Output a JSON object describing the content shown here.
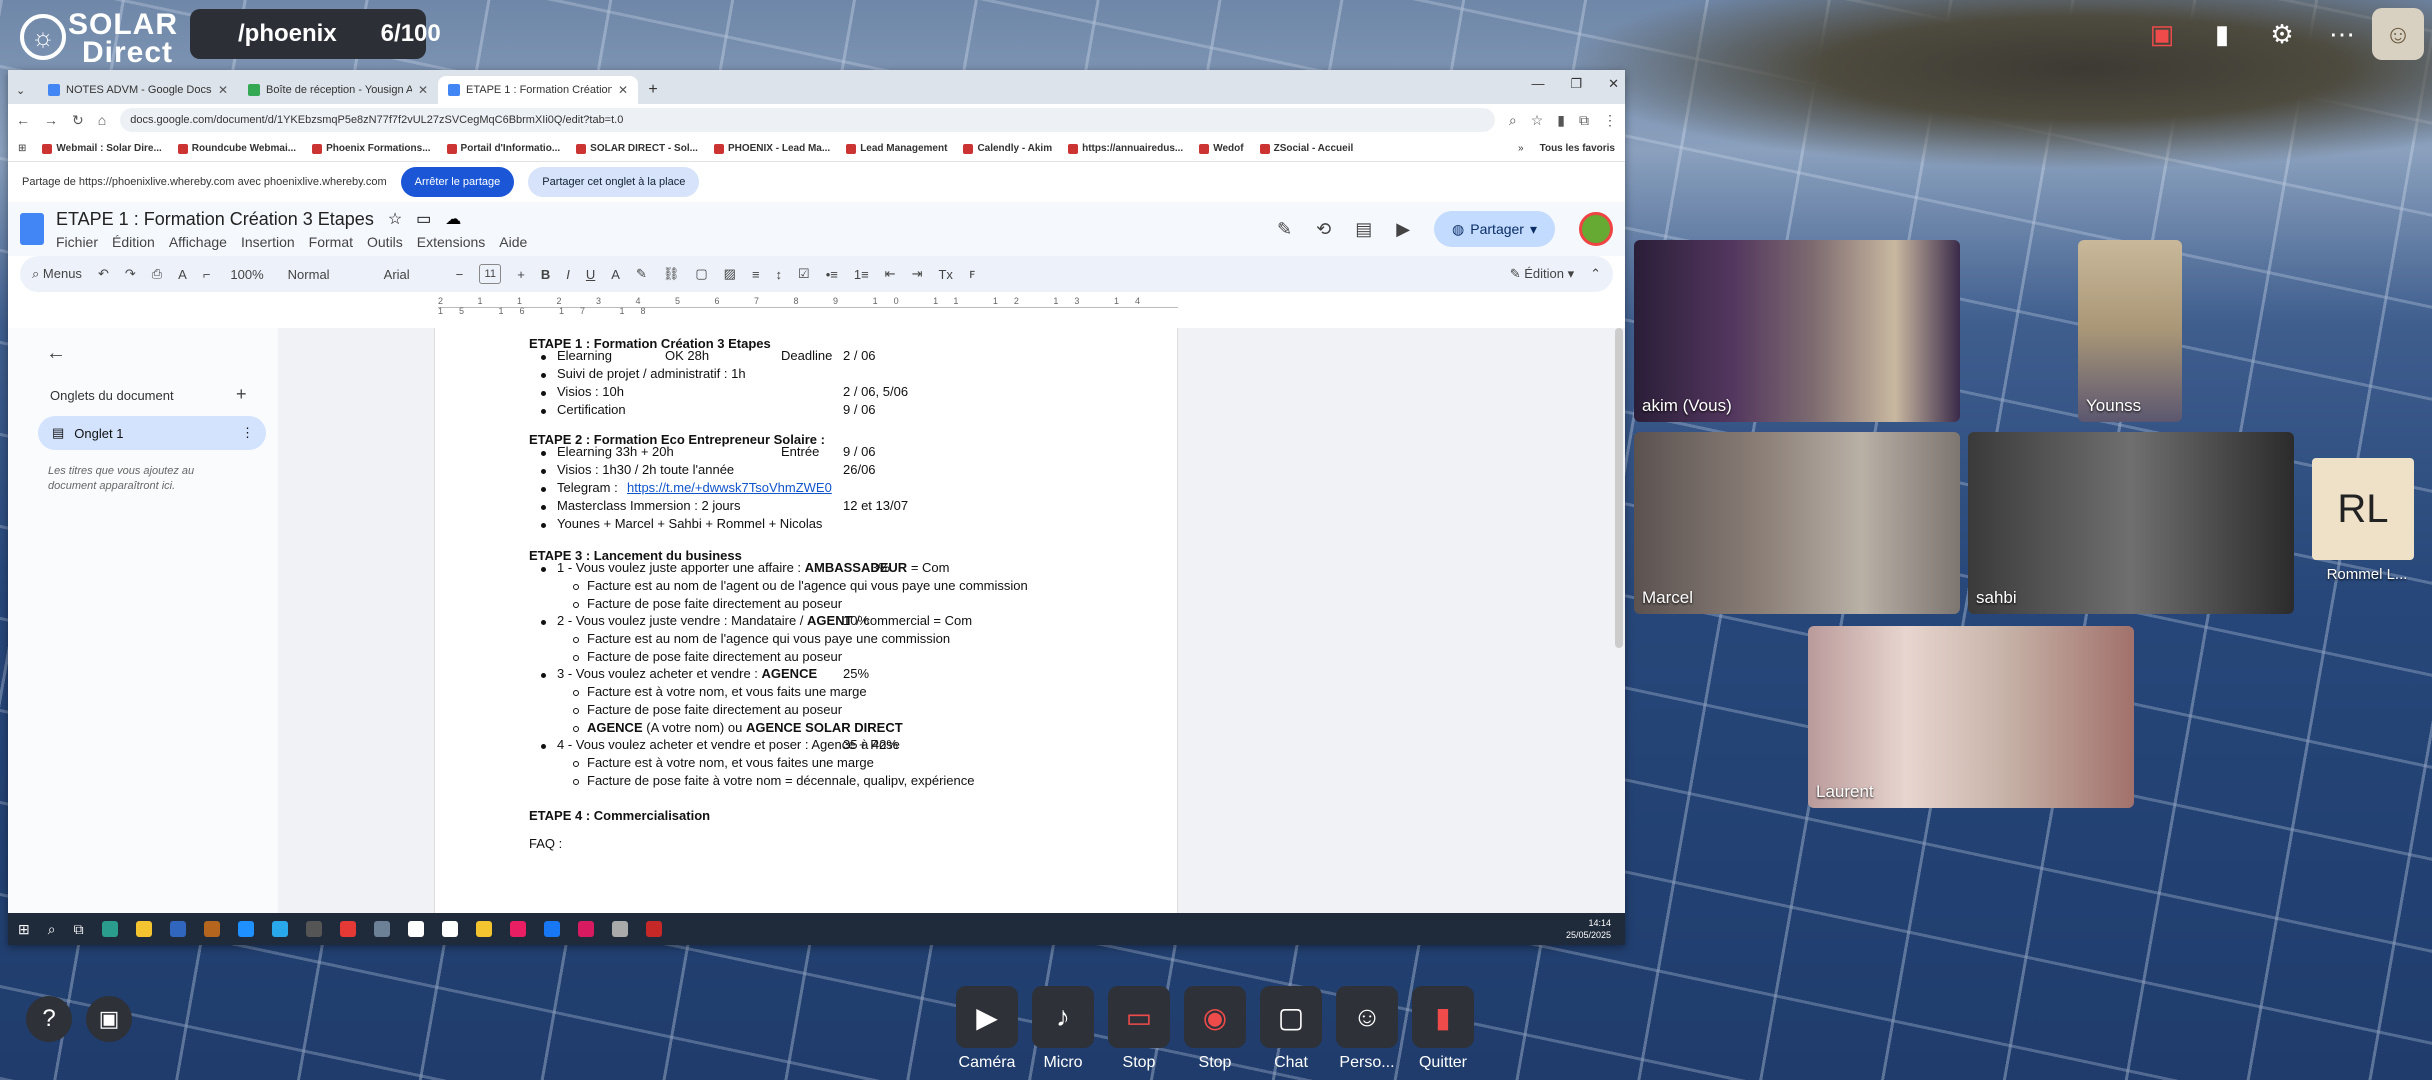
{
  "app": {
    "logo_top": "SOLAR",
    "logo_bottom": "Direct",
    "room": "/phoenix",
    "count": "6/100"
  },
  "browser": {
    "tabs": [
      {
        "label": "NOTES ADVM - Google Docs"
      },
      {
        "label": "Boîte de réception - Yousign A..."
      },
      {
        "label": "ETAPE 1 : Formation Création 3..."
      }
    ],
    "url": "docs.google.com/document/d/1YKEbzsmqP5e8zN77f7f2vUL27zSVCegMqC6BbrmXIi0Q/edit?tab=t.0",
    "bookmarks": [
      "Webmail : Solar Dire...",
      "Roundcube Webmai...",
      "Phoenix Formations...",
      "Portail d'Informatio...",
      "SOLAR DIRECT - Sol...",
      "PHOENIX - Lead Ma...",
      "Lead Management",
      "Calendly - Akim",
      "https://annuairedus...",
      "Wedof",
      "ZSocial - Accueil",
      "Tous les favoris"
    ],
    "share_text": "Partage de https://phoenixlive.whereby.com avec phoenixlive.whereby.com",
    "stop_share": "Arrêter le partage",
    "share_tab": "Partager cet onglet à la place"
  },
  "doc": {
    "title": "ETAPE 1 : Formation Création 3 Etapes",
    "menus": [
      "Fichier",
      "Édition",
      "Affichage",
      "Insertion",
      "Format",
      "Outils",
      "Extensions",
      "Aide"
    ],
    "share_btn": "Partager",
    "toolbar": {
      "menus": "Menus",
      "zoom": "100%",
      "style": "Normal",
      "font": "Arial",
      "size": "11",
      "mode": "Édition"
    },
    "sidebar": {
      "heading": "Onglets du document",
      "tab": "Onglet 1",
      "hint": "Les titres que vous ajoutez au document apparaîtront ici."
    },
    "ruler": "2 1 1 2 3 4 5 6 7 8 9 10 11 12 13 14 15 16 17 18",
    "content": {
      "e1": "ETAPE 1 : Formation Création 3 Etapes",
      "e1a": "Elearning",
      "e1a2": "OK 28h",
      "e1a3": "Deadline",
      "e1a4": "2 / 06",
      "e1b": "Suivi de projet / administratif : 1h",
      "e1c": "Visios : 10h",
      "e1c2": "2 / 06, 5/06",
      "e1d": "Certification",
      "e1d2": "9 / 06",
      "e2": "ETAPE 2 : Formation Eco Entrepreneur Solaire :",
      "e2a": "Elearning 33h + 20h",
      "e2a2": "Entrée",
      "e2a3": "9 / 06",
      "e2b": "Visios : 1h30 / 2h toute l'année",
      "e2b2": "26/06",
      "e2c": "Telegram :",
      "e2c2": "https://t.me/+dwwsk7TsoVhmZWE0",
      "e2d": "Masterclass Immersion : 2 jours",
      "e2d2": "12 et 13/07",
      "e2e": "Younes + Marcel + Sahbi + Rommel + Nicolas",
      "e3": "ETAPE 3 : Lancement du business",
      "e3a": "1 - Vous voulez juste apporter une affaire : ",
      "e3a_b": "AMBASSADEUR",
      "e3a_c": " = Com",
      "e3a2": "3%",
      "e3a_s1": "Facture est au nom de l'agent ou de l'agence qui vous paye une commission",
      "e3a_s2": "Facture de pose faite directement au poseur",
      "e3b": "2 - Vous voulez juste vendre : Mandataire / ",
      "e3b_b": "AGENT",
      "e3b_c": " / commercial = Com",
      "e3b2": "10%",
      "e3b_s1": "Facture est au nom de l'agence qui vous paye une commission",
      "e3b_s2": "Facture de pose faite directement au poseur",
      "e3c": "3 - Vous voulez acheter et vendre : ",
      "e3c_b": "AGENCE",
      "e3c2": "25%",
      "e3c_s1": "Facture est à votre nom, et vous faits une marge",
      "e3c_s2": "Facture de pose faite directement au poseur",
      "e3c_s3a": "AGENCE",
      "e3c_s3b": " (A votre nom) ou ",
      "e3c_s3c": "AGENCE SOLAR DIRECT",
      "e3d": "4 - Vous voulez acheter et vendre et poser : Agence + Pose",
      "e3d2": "35 à 42%",
      "e3d_s1": "Facture est à votre nom, et vous faites une marge",
      "e3d_s2": "Facture de pose faite à votre nom = décennale, qualipv, expérience",
      "e4": "ETAPE 4 : Commercialisation",
      "faq": "FAQ :"
    }
  },
  "clock": {
    "time": "14:14",
    "date": "25/05/2025"
  },
  "participants": [
    {
      "name": "akim (Vous)"
    },
    {
      "name": "Younss"
    },
    {
      "name": "Marcel"
    },
    {
      "name": "sahbi"
    },
    {
      "name": "Laurent"
    },
    {
      "name": "Rommel L...",
      "initials": "RL"
    }
  ],
  "controls": [
    "Caméra",
    "Micro",
    "Stop",
    "Stop",
    "Chat",
    "Perso...",
    "Quitter"
  ]
}
